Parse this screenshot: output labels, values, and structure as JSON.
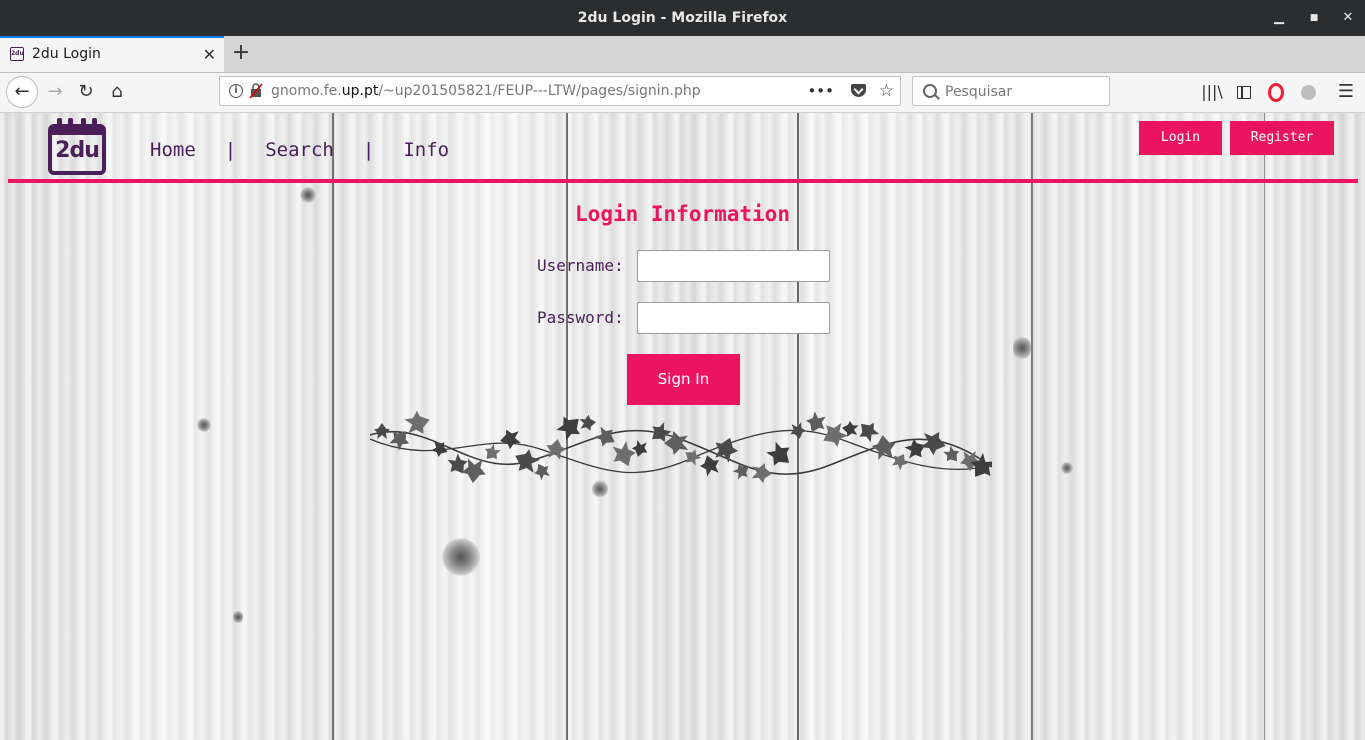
{
  "window": {
    "title": "2du Login - Mozilla Firefox",
    "minimize": "▁",
    "maximize": "■",
    "close": "✕"
  },
  "tabs": {
    "active": {
      "label": "2du Login",
      "favicon": "2du",
      "close": "✕"
    },
    "new_tab": "+"
  },
  "navbar": {
    "back": "←",
    "forward": "→",
    "reload": "↻",
    "home": "⌂",
    "url_prefix": "gnomo.fe.",
    "url_host": "up.pt",
    "url_path": "/~up201505821/FEUP---LTW/pages/signin.php",
    "info": "i",
    "page_actions": "•••",
    "star": "☆",
    "search_placeholder": "Pesquisar",
    "library": "|||\\",
    "menu": "☰"
  },
  "site": {
    "logo_text": "2du",
    "nav": {
      "home": "Home",
      "separator": "|",
      "search": "Search",
      "info": "Info"
    },
    "login_label": "Login",
    "register_label": "Register",
    "accent_color": "#ec1460",
    "brand_color": "#4a1e59"
  },
  "form": {
    "title": "Login Information",
    "username_label": "Username:",
    "password_label": "Password:",
    "username_value": "",
    "password_value": "",
    "submit_label": "Sign In"
  }
}
